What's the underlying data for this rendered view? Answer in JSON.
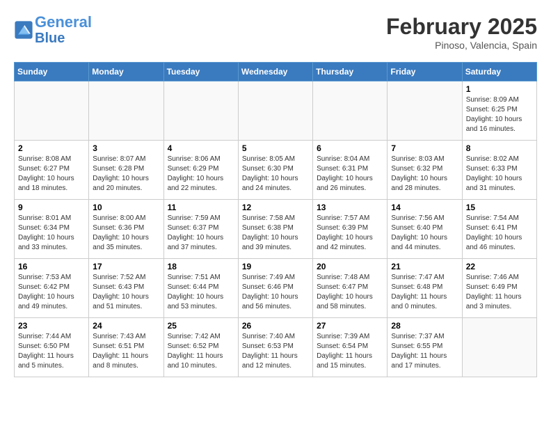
{
  "header": {
    "logo_line1": "General",
    "logo_line2": "Blue",
    "month_title": "February 2025",
    "location": "Pinoso, Valencia, Spain"
  },
  "days_of_week": [
    "Sunday",
    "Monday",
    "Tuesday",
    "Wednesday",
    "Thursday",
    "Friday",
    "Saturday"
  ],
  "weeks": [
    [
      {
        "num": "",
        "info": ""
      },
      {
        "num": "",
        "info": ""
      },
      {
        "num": "",
        "info": ""
      },
      {
        "num": "",
        "info": ""
      },
      {
        "num": "",
        "info": ""
      },
      {
        "num": "",
        "info": ""
      },
      {
        "num": "1",
        "info": "Sunrise: 8:09 AM\nSunset: 6:25 PM\nDaylight: 10 hours\nand 16 minutes."
      }
    ],
    [
      {
        "num": "2",
        "info": "Sunrise: 8:08 AM\nSunset: 6:27 PM\nDaylight: 10 hours\nand 18 minutes."
      },
      {
        "num": "3",
        "info": "Sunrise: 8:07 AM\nSunset: 6:28 PM\nDaylight: 10 hours\nand 20 minutes."
      },
      {
        "num": "4",
        "info": "Sunrise: 8:06 AM\nSunset: 6:29 PM\nDaylight: 10 hours\nand 22 minutes."
      },
      {
        "num": "5",
        "info": "Sunrise: 8:05 AM\nSunset: 6:30 PM\nDaylight: 10 hours\nand 24 minutes."
      },
      {
        "num": "6",
        "info": "Sunrise: 8:04 AM\nSunset: 6:31 PM\nDaylight: 10 hours\nand 26 minutes."
      },
      {
        "num": "7",
        "info": "Sunrise: 8:03 AM\nSunset: 6:32 PM\nDaylight: 10 hours\nand 28 minutes."
      },
      {
        "num": "8",
        "info": "Sunrise: 8:02 AM\nSunset: 6:33 PM\nDaylight: 10 hours\nand 31 minutes."
      }
    ],
    [
      {
        "num": "9",
        "info": "Sunrise: 8:01 AM\nSunset: 6:34 PM\nDaylight: 10 hours\nand 33 minutes."
      },
      {
        "num": "10",
        "info": "Sunrise: 8:00 AM\nSunset: 6:36 PM\nDaylight: 10 hours\nand 35 minutes."
      },
      {
        "num": "11",
        "info": "Sunrise: 7:59 AM\nSunset: 6:37 PM\nDaylight: 10 hours\nand 37 minutes."
      },
      {
        "num": "12",
        "info": "Sunrise: 7:58 AM\nSunset: 6:38 PM\nDaylight: 10 hours\nand 39 minutes."
      },
      {
        "num": "13",
        "info": "Sunrise: 7:57 AM\nSunset: 6:39 PM\nDaylight: 10 hours\nand 42 minutes."
      },
      {
        "num": "14",
        "info": "Sunrise: 7:56 AM\nSunset: 6:40 PM\nDaylight: 10 hours\nand 44 minutes."
      },
      {
        "num": "15",
        "info": "Sunrise: 7:54 AM\nSunset: 6:41 PM\nDaylight: 10 hours\nand 46 minutes."
      }
    ],
    [
      {
        "num": "16",
        "info": "Sunrise: 7:53 AM\nSunset: 6:42 PM\nDaylight: 10 hours\nand 49 minutes."
      },
      {
        "num": "17",
        "info": "Sunrise: 7:52 AM\nSunset: 6:43 PM\nDaylight: 10 hours\nand 51 minutes."
      },
      {
        "num": "18",
        "info": "Sunrise: 7:51 AM\nSunset: 6:44 PM\nDaylight: 10 hours\nand 53 minutes."
      },
      {
        "num": "19",
        "info": "Sunrise: 7:49 AM\nSunset: 6:46 PM\nDaylight: 10 hours\nand 56 minutes."
      },
      {
        "num": "20",
        "info": "Sunrise: 7:48 AM\nSunset: 6:47 PM\nDaylight: 10 hours\nand 58 minutes."
      },
      {
        "num": "21",
        "info": "Sunrise: 7:47 AM\nSunset: 6:48 PM\nDaylight: 11 hours\nand 0 minutes."
      },
      {
        "num": "22",
        "info": "Sunrise: 7:46 AM\nSunset: 6:49 PM\nDaylight: 11 hours\nand 3 minutes."
      }
    ],
    [
      {
        "num": "23",
        "info": "Sunrise: 7:44 AM\nSunset: 6:50 PM\nDaylight: 11 hours\nand 5 minutes."
      },
      {
        "num": "24",
        "info": "Sunrise: 7:43 AM\nSunset: 6:51 PM\nDaylight: 11 hours\nand 8 minutes."
      },
      {
        "num": "25",
        "info": "Sunrise: 7:42 AM\nSunset: 6:52 PM\nDaylight: 11 hours\nand 10 minutes."
      },
      {
        "num": "26",
        "info": "Sunrise: 7:40 AM\nSunset: 6:53 PM\nDaylight: 11 hours\nand 12 minutes."
      },
      {
        "num": "27",
        "info": "Sunrise: 7:39 AM\nSunset: 6:54 PM\nDaylight: 11 hours\nand 15 minutes."
      },
      {
        "num": "28",
        "info": "Sunrise: 7:37 AM\nSunset: 6:55 PM\nDaylight: 11 hours\nand 17 minutes."
      },
      {
        "num": "",
        "info": ""
      }
    ]
  ]
}
